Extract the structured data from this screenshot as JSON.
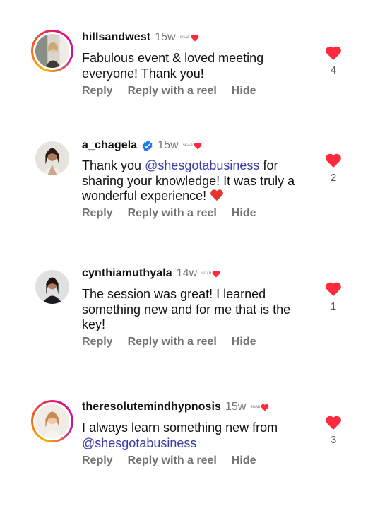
{
  "colors": {
    "heart": "#ff2a3d",
    "mention": "#3a3aa8",
    "muted": "#737373",
    "verified": "#1d7bf2"
  },
  "comments": [
    {
      "username": "hillsandwest",
      "time": "15w",
      "verified": false,
      "avatar_story_ring": true,
      "text_segments": [
        {
          "type": "text",
          "value": "Fabulous event & loved meeting everyone! Thank you!"
        }
      ],
      "likes": "4",
      "actions": [
        "Reply",
        "Reply with a reel",
        "Hide"
      ]
    },
    {
      "username": "a_chagela",
      "time": "15w",
      "verified": true,
      "avatar_story_ring": false,
      "text_segments": [
        {
          "type": "text",
          "value": "Thank you "
        },
        {
          "type": "mention",
          "value": "@shesgotabusiness"
        },
        {
          "type": "text",
          "value": " for sharing your knowledge! It was truly a wonderful experience! "
        },
        {
          "type": "emoji",
          "value": "red-heart-emoji"
        }
      ],
      "likes": "2",
      "actions": [
        "Reply",
        "Reply with a reel",
        "Hide"
      ]
    },
    {
      "username": "cynthiamuthyala",
      "time": "14w",
      "verified": false,
      "avatar_story_ring": false,
      "text_segments": [
        {
          "type": "text",
          "value": "The session was great! I learned something new and for me that is the key!"
        }
      ],
      "likes": "1",
      "actions": [
        "Reply",
        "Reply with a reel",
        "Hide"
      ]
    },
    {
      "username": "theresolutemindhypnosis",
      "time": "15w",
      "verified": false,
      "avatar_story_ring": true,
      "text_segments": [
        {
          "type": "text",
          "value": "I always learn something new from "
        },
        {
          "type": "mention",
          "value": "@shesgotabusiness"
        }
      ],
      "likes": "3",
      "actions": [
        "Reply",
        "Reply with a reel",
        "Hide"
      ]
    }
  ]
}
